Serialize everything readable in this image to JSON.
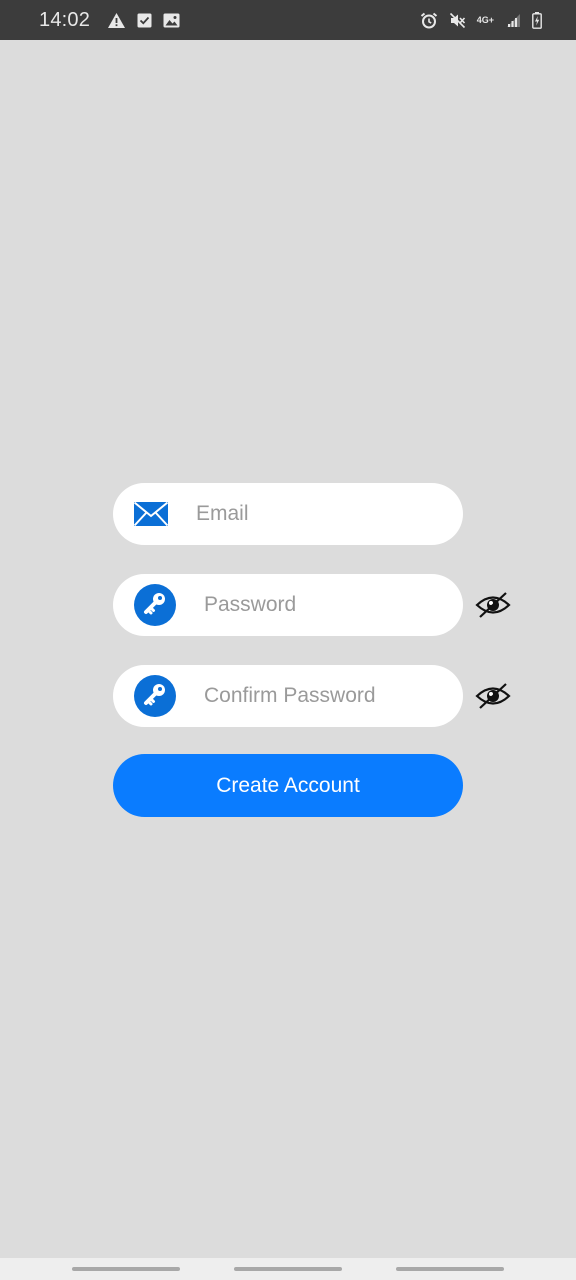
{
  "status_bar": {
    "time": "14:02",
    "left_icons": [
      "warning-icon",
      "checkbox-icon",
      "image-icon"
    ],
    "right_icons": [
      "alarm-icon",
      "mute-icon",
      "network-4g-icon",
      "signal-icon",
      "battery-charging-icon"
    ],
    "network_label": "4G+"
  },
  "form": {
    "email": {
      "placeholder": "Email",
      "icon": "mail-icon"
    },
    "password": {
      "placeholder": "Password",
      "icon": "key-icon",
      "toggle_icon": "eye-off-icon"
    },
    "confirm_password": {
      "placeholder": "Confirm Password",
      "icon": "key-icon",
      "toggle_icon": "eye-off-icon"
    },
    "submit_label": "Create Account"
  },
  "colors": {
    "accent": "#0a7cff",
    "icon_blue": "#0b6fd6",
    "background": "#dcdcdc",
    "status_bar": "#3c3c3c"
  }
}
